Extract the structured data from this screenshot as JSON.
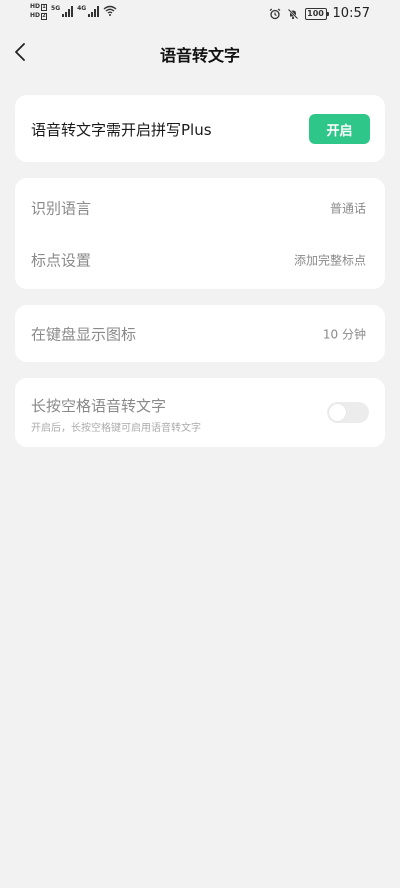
{
  "status_bar": {
    "hd_1": "HD",
    "hd_2": "HD",
    "sig1_tag": "5G",
    "sig2_tag": "4G",
    "battery": "100",
    "time": "10:57"
  },
  "nav": {
    "title": "语音转文字",
    "back_icon": "chevron-left-icon"
  },
  "plus_card": {
    "text": "语音转文字需开启拼写Plus",
    "button_label": "开启",
    "accent_color": "#2ec789"
  },
  "settings": [
    {
      "label": "识别语言",
      "value": "普通话"
    },
    {
      "label": "标点设置",
      "value": "添加完整标点"
    }
  ],
  "keyboard_icon": {
    "label": "在键盘显示图标",
    "value": "10 分钟"
  },
  "long_press": {
    "label": "长按空格语音转文字",
    "description": "开启后，长按空格键可启用语音转文字",
    "enabled": false
  }
}
